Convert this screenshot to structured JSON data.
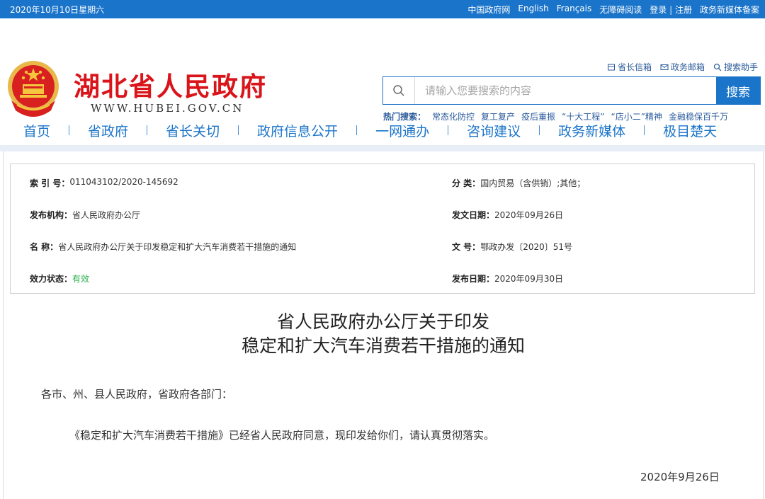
{
  "topbar": {
    "date": "2020年10月10日星期六",
    "links": [
      "中国政府网",
      "English",
      "Français",
      "无障碍阅读"
    ],
    "login": "登录",
    "divider": "|",
    "register": "注册",
    "media": "政务新媒体备案"
  },
  "header": {
    "title": "湖北省人民政府",
    "url": "WWW.HUBEI.GOV.CN",
    "tools": {
      "mailbox": "省长信箱",
      "email": "政务邮箱",
      "assistant": "搜索助手"
    },
    "search": {
      "placeholder": "请输入您要搜索的内容",
      "button": "搜索"
    },
    "hot": {
      "label": "热门搜索：",
      "items": [
        "常态化防控",
        "复工复产",
        "疫后重振",
        "“十大工程”",
        "“店小二”精神",
        "金融稳保百千万"
      ]
    }
  },
  "nav": {
    "items": [
      "首页",
      "省政府",
      "省长关切",
      "政府信息公开",
      "一网通办",
      "咨询建议",
      "政务新媒体",
      "极目楚天"
    ]
  },
  "meta": {
    "index_label": "索 引 号：",
    "index_value": "011043102/2020-145692",
    "category_label": "分  类：",
    "category_value": "国内贸易（含供销）;其他；",
    "org_label": "发布机构：",
    "org_value": "省人民政府办公厅",
    "issue_date_label": "发文日期：",
    "issue_date_value": "2020年09月26日",
    "name_label": "名  称：",
    "name_value": "省人民政府办公厅关于印发稳定和扩大汽车消费若干措施的通知",
    "doc_no_label": "文  号：",
    "doc_no_value": "鄂政办发〔2020〕51号",
    "status_label": "效力状态：",
    "status_value": "有效",
    "publish_date_label": "发布日期：",
    "publish_date_value": "2020年09月30日"
  },
  "document": {
    "title_line1": "省人民政府办公厅关于印发",
    "title_line2": "稳定和扩大汽车消费若干措施的通知",
    "salutation": "各市、州、县人民政府，省政府各部门：",
    "body": "《稳定和扩大汽车消费若干措施》已经省人民政府同意，现印发给你们，请认真贯彻落实。",
    "date": "2020年9月26日"
  },
  "colors": {
    "brand_blue": "#1a74c9",
    "title_red": "#d9141a",
    "status_green": "#2bb24c"
  }
}
